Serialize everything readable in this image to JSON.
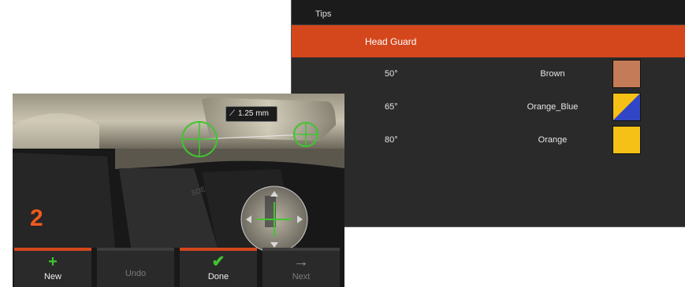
{
  "tips_panel": {
    "title": "Tips",
    "selected": "Head Guard",
    "rows": [
      {
        "angle": "50°",
        "color_name": "Brown",
        "swatch": "#c47b57"
      },
      {
        "angle": "65°",
        "color_name": "Orange_Blue",
        "swatch": "split-yellow-blue"
      },
      {
        "angle": "80°",
        "color_name": "Orange",
        "swatch": "#f5c116"
      }
    ]
  },
  "camera_view": {
    "step_number": "2",
    "measurement": "1.25 mm",
    "measurement_icon": "ruler-diagonal-icon"
  },
  "toolbar": {
    "buttons": [
      {
        "label": "New",
        "icon": "plus-icon",
        "enabled": true
      },
      {
        "label": "Undo",
        "icon": "",
        "enabled": false
      },
      {
        "label": "Done",
        "icon": "check-icon",
        "enabled": true
      },
      {
        "label": "Next",
        "icon": "arrow-right-icon",
        "enabled": false
      }
    ]
  },
  "colors": {
    "accent": "#d4471c",
    "step_number": "#ef5a1e",
    "cursor_green": "#3fc52f",
    "panel_bg": "#2a2a2a"
  }
}
